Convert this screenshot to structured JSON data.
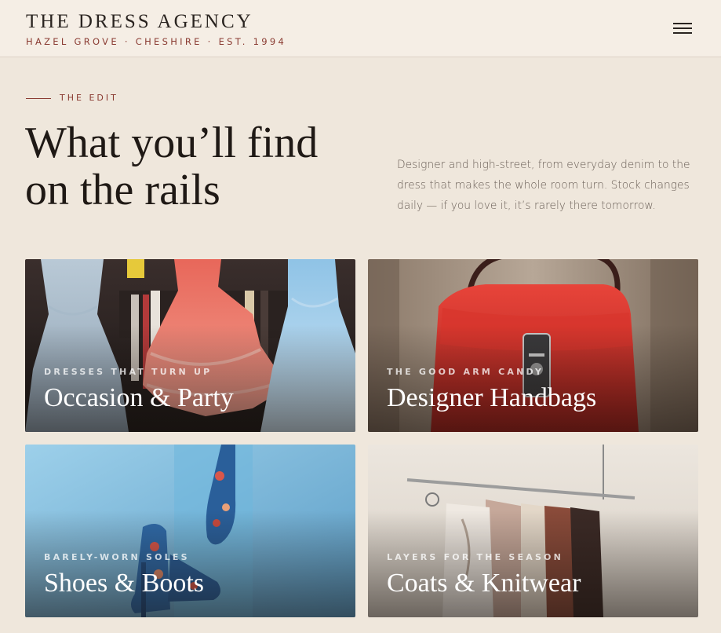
{
  "header": {
    "brand": "THE DRESS AGENCY",
    "tagline": "HAZEL GROVE · CHESHIRE · EST. 1994",
    "menu_icon": "hamburger-menu-icon"
  },
  "intro": {
    "eyebrow": "THE EDIT",
    "headline_line1": "What you’ll find",
    "headline_line2": "on the rails",
    "lead": "Designer and high-street, from everyday denim to the dress that makes the whole room turn. Stock changes daily — if you love it, it’s rarely there tomorrow."
  },
  "categories": [
    {
      "kicker": "DRESSES THAT TURN UP",
      "title": "Occasion & Party"
    },
    {
      "kicker": "THE GOOD ARM CANDY",
      "title": "Designer Handbags"
    },
    {
      "kicker": "BARELY-WORN SOLES",
      "title": "Shoes & Boots"
    },
    {
      "kicker": "LAYERS FOR THE SEASON",
      "title": "Coats & Knitwear"
    }
  ],
  "colors": {
    "background": "#efe7dc",
    "header_bg": "#f5eee5",
    "accent": "#8a3b32",
    "ink": "#1f1915"
  }
}
